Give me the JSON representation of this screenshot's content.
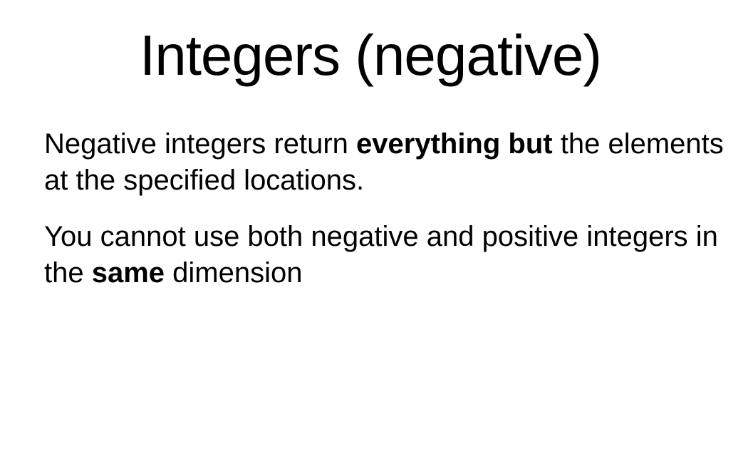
{
  "slide": {
    "title": "Integers (negative)",
    "paragraphs": [
      {
        "before": "Negative integers return ",
        "bold": "everything but",
        "after": " the elements at the specified locations."
      },
      {
        "before": "You cannot use both negative and positive integers in the ",
        "bold": "same",
        "after": " dimension"
      }
    ]
  }
}
